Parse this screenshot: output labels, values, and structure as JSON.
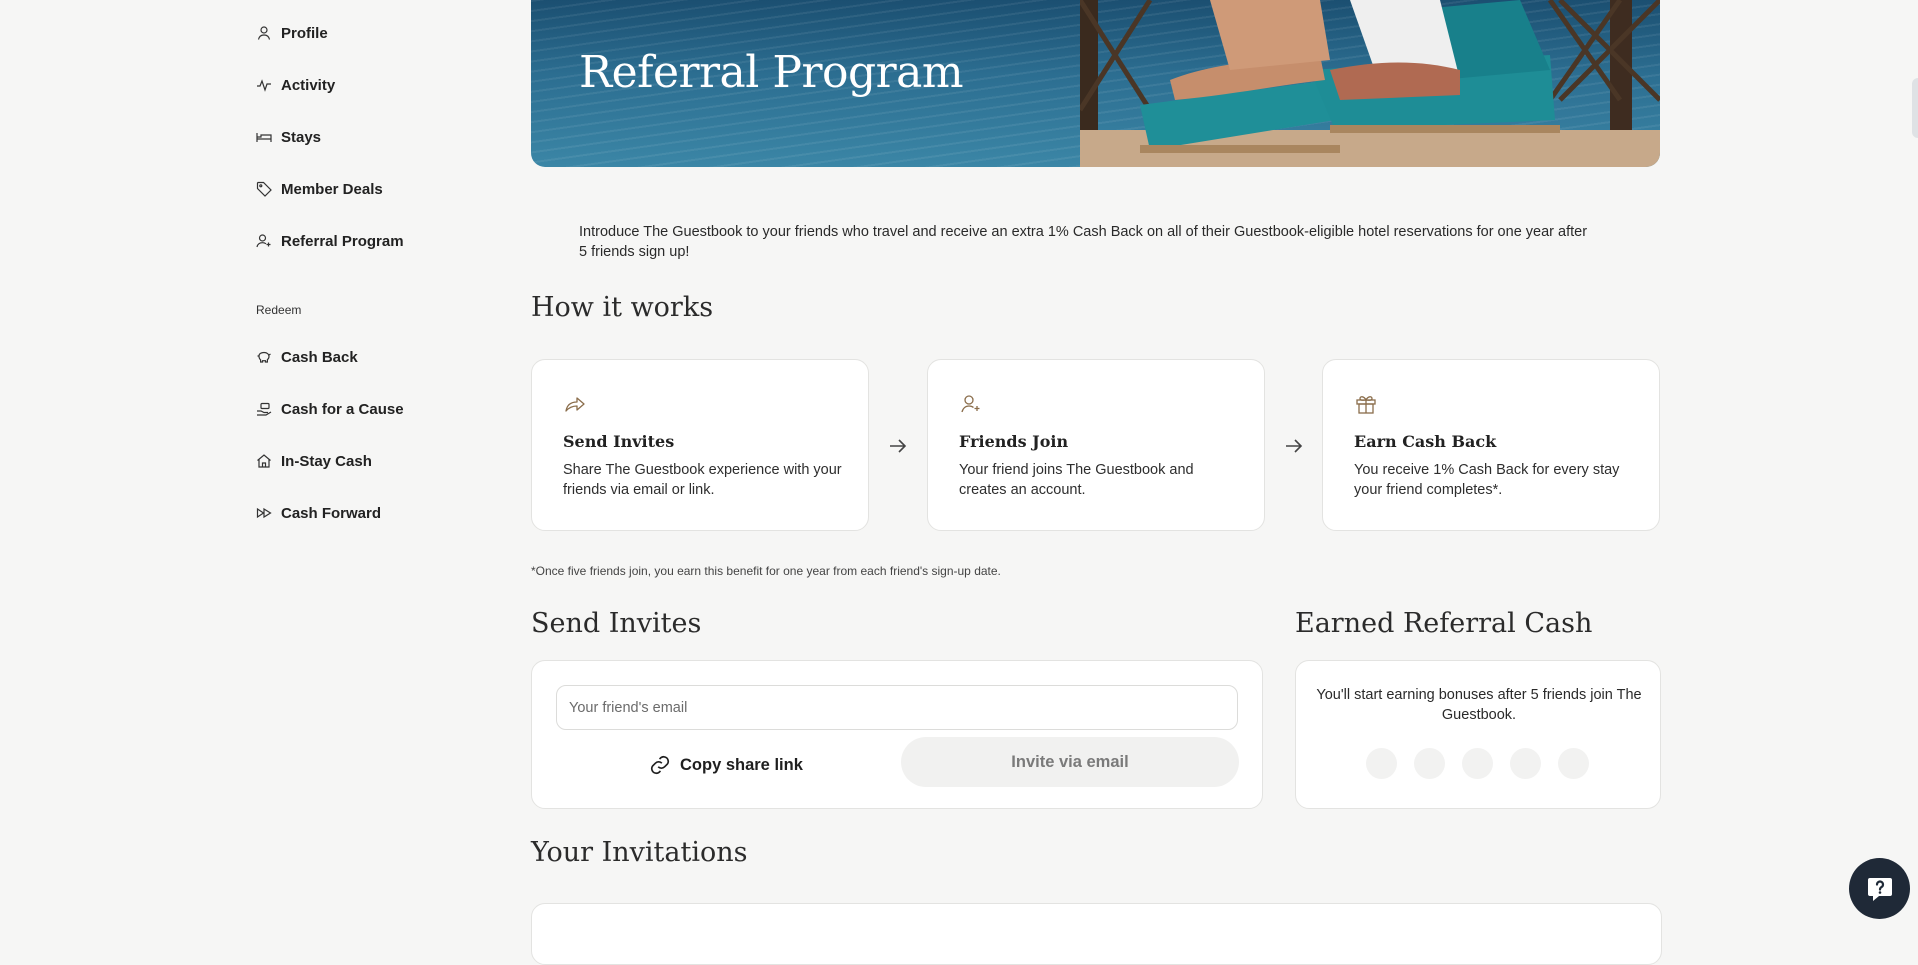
{
  "sidebar": {
    "items": [
      {
        "label": "Profile",
        "icon": "user-icon"
      },
      {
        "label": "Activity",
        "icon": "activity-icon"
      },
      {
        "label": "Stays",
        "icon": "bed-icon"
      },
      {
        "label": "Member Deals",
        "icon": "tag-icon"
      },
      {
        "label": "Referral Program",
        "icon": "user-plus-icon"
      }
    ],
    "redeem_heading": "Redeem",
    "redeem_items": [
      {
        "label": "Cash Back",
        "icon": "piggy-bank-icon"
      },
      {
        "label": "Cash for a Cause",
        "icon": "donate-icon"
      },
      {
        "label": "In-Stay Cash",
        "icon": "home-icon"
      },
      {
        "label": "Cash Forward",
        "icon": "fast-forward-icon"
      }
    ]
  },
  "hero": {
    "title": "Referral Program"
  },
  "intro": "Introduce The Guestbook to your friends who travel and receive an extra 1% Cash Back on all of their Guestbook-eligible hotel reservations for one year after 5 friends sign up!",
  "how_it_works": {
    "heading": "How it works",
    "steps": [
      {
        "title": "Send Invites",
        "desc": "Share The Guestbook experience with your friends via email or link.",
        "icon": "share-icon"
      },
      {
        "title": "Friends Join",
        "desc": "Your friend joins The Guestbook and creates an account.",
        "icon": "user-plus-icon"
      },
      {
        "title": "Earn Cash Back",
        "desc": "You receive 1% Cash Back for every stay your friend completes*.",
        "icon": "gift-icon"
      }
    ],
    "footnote": "*Once five friends join, you earn this benefit for one year from each friend's sign-up date."
  },
  "send_invites": {
    "heading": "Send Invites",
    "email_placeholder": "Your friend's email",
    "email_value": "",
    "copy_link_label": "Copy share link",
    "invite_button_label": "Invite via email"
  },
  "earned": {
    "heading": "Earned Referral Cash",
    "message": "You'll start earning bonuses after 5 friends join The Guestbook.",
    "friends_joined": 0,
    "friends_required": 5
  },
  "invitations": {
    "heading": "Your Invitations"
  },
  "colors": {
    "background": "#f6f6f5",
    "card": "#ffffff",
    "icon_accent": "#8a6d4b",
    "help_button": "#1f2937"
  }
}
